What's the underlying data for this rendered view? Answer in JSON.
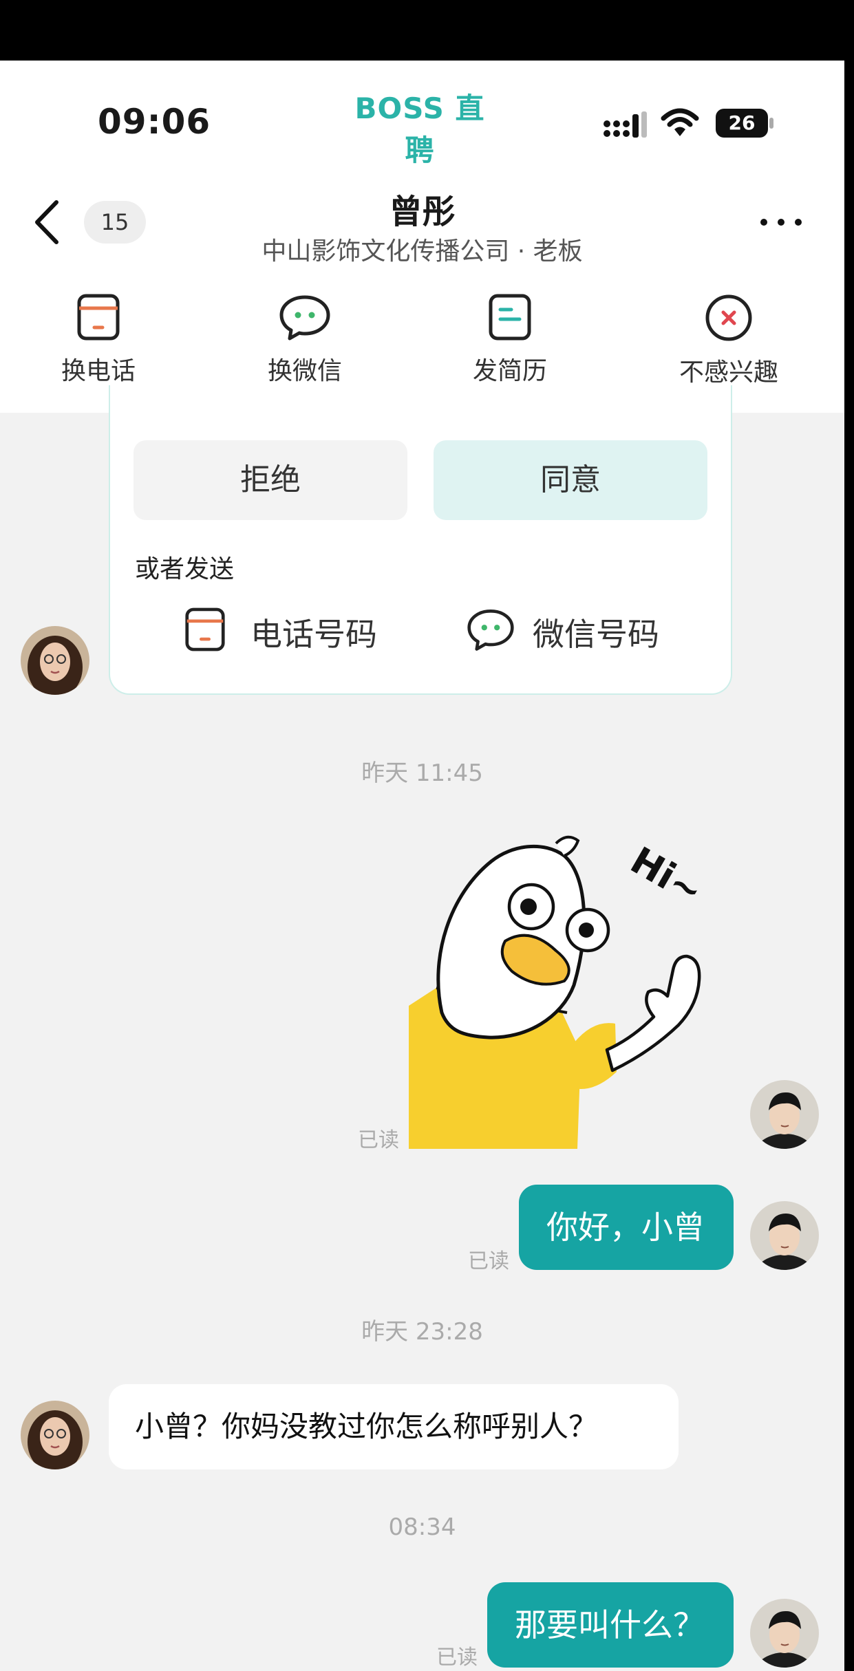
{
  "status_bar": {
    "time": "09:06",
    "app_brand": "BOSS 直聘",
    "battery": "26"
  },
  "chat_header": {
    "unread_count": "15",
    "name": "曾彤",
    "subtitle": "中山影饰文化传播公司 · 老板"
  },
  "actions": [
    {
      "label": "换电话",
      "icon": "phone-card-icon"
    },
    {
      "label": "换微信",
      "icon": "wechat-icon"
    },
    {
      "label": "发简历",
      "icon": "resume-icon"
    },
    {
      "label": "不感兴趣",
      "icon": "not-interested-icon"
    }
  ],
  "request_card": {
    "reject_label": "拒绝",
    "accept_label": "同意",
    "or_send": "或者发送",
    "phone_option": "电话号码",
    "wechat_option": "微信号码"
  },
  "messages": {
    "ts1": "昨天 11:45",
    "sticker_read": "已读",
    "msg1_text": "你好，小曾",
    "msg1_read": "已读",
    "ts2": "昨天 23:28",
    "msg2_text": "小曾？你妈没教过你怎么称呼别人？",
    "ts3": "08:34",
    "msg3_text": "那要叫什么？",
    "msg3_read": "已读"
  },
  "sticker": {
    "text": "Hi~"
  },
  "colors": {
    "brand": "#2bb3a8",
    "bubble_out": "#16a4a3",
    "accept_bg": "#dff3f2",
    "icon_orange": "#e8774b",
    "icon_green": "#3fb66b",
    "icon_red": "#e0474f"
  }
}
